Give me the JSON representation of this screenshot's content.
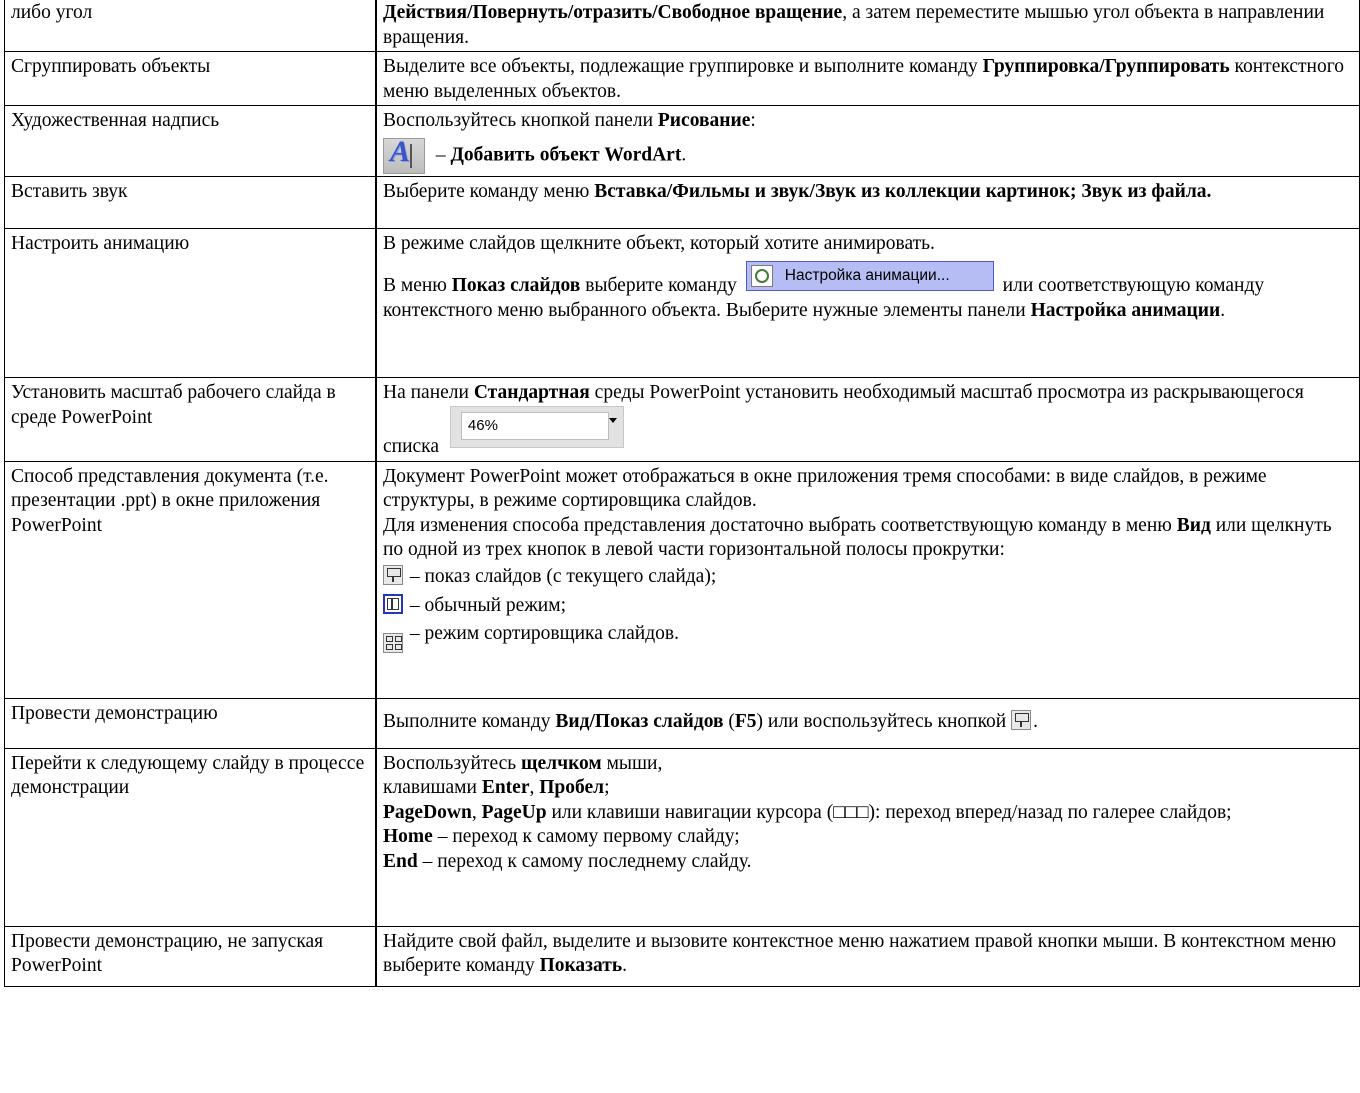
{
  "rows": [
    {
      "left": "либо угол",
      "right": {
        "b1": "Действия/Повернуть/отразить/Свободное вращение",
        "t1": ", а затем переместите мышью угол объекта в направлении вращения."
      }
    },
    {
      "left": "Сгруппировать объекты",
      "right": {
        "t1": "Выделите все объекты, подлежащие группировке и выполните команду ",
        "b1": "Группировка/Группировать",
        "t2": " контекстного меню выделенных объектов."
      }
    },
    {
      "left": "Художественная надпись",
      "right": {
        "t1": "Воспользуйтесь кнопкой панели ",
        "b1": "Рисование",
        "t2": ":",
        "t3": " – ",
        "b2": "Добавить объект WordArt",
        "t4": "."
      }
    },
    {
      "left": "Вставить звук",
      "right": {
        "t1": "Выберите команду меню ",
        "b1": "Вставка/Фильмы и звук/Звук из коллекции картинок; Звук из файла."
      }
    },
    {
      "left": "Настроить анимацию",
      "right": {
        "p1": "В режиме слайдов щелкните объект, который хотите анимировать.",
        "t1": "В меню ",
        "b1": "Показ слайдов",
        "t2": " выберите команду ",
        "btn": "Настройка анимации...",
        "t3": " или соответствующую команду контекстного меню выбранного объекта. Выберите нужные элементы панели ",
        "b2": "Настройка анимации",
        "t4": "."
      }
    },
    {
      "left": "Установить масштаб рабочего слайда в среде PowerPoint",
      "right": {
        "t1": "На панели ",
        "b1": "Стандартная",
        "t2": " среды PowerPoint установить необходимый масштаб просмотра из раскрывающегося списка ",
        "zoom": "46%"
      }
    },
    {
      "left": "Способ представления документа (т.е. презентации .ppt) в окне приложения PowerPoint",
      "right": {
        "p1": "Документ PowerPoint может отображаться в окне приложения тремя способами: в виде слайдов, в режиме структуры, в режиме сортировщика слайдов.",
        "t1": "Для изменения способа представления достаточно выбрать соответствующую команду в меню ",
        "b1": "Вид",
        "t2": "  или щелкнуть по одной из трех кнопок в левой части горизонтальной полосы прокрутки:",
        "i1": " – показ слайдов (с текущего слайда);",
        "i2": " – обычный режим;",
        "i3": " – режим сортировщика слайдов."
      }
    },
    {
      "left": "Провести демонстрацию",
      "right": {
        "t1": "Выполните команду ",
        "b1": "Вид/Показ слайдов",
        "t2": " (",
        "b2": "F5",
        "t3": ") или воспользуйтесь кнопкой ",
        "t4": "."
      }
    },
    {
      "left": "Перейти к следующему слайду в процессе демонстрации",
      "right": {
        "t1": "Воспользуйтесь ",
        "b1": "щелчком",
        "t2": " мыши,",
        "t3": "клавишами ",
        "b2": "Enter",
        "t4": ", ",
        "b3": "Пробел",
        "t5": ";",
        "b4": "PageDown",
        "t6": ", ",
        "b5": "PageUp",
        "t7": " или клавиши навигации курсора (□□□):  переход вперед/назад по галерее слайдов;",
        "b6": "Home",
        "t8": " – переход к самому первому слайду;",
        "b7": "End",
        "t9": " – переход к самому последнему слайду."
      }
    },
    {
      "left": "Провести демонстрацию, не запуская  PowerPoint",
      "right": {
        "t1": "Найдите свой файл, выделите и вызовите контекстное меню нажатием правой кнопки мыши. В контекстном меню выберите команду ",
        "b1": "Показать",
        "t2": "."
      }
    }
  ]
}
